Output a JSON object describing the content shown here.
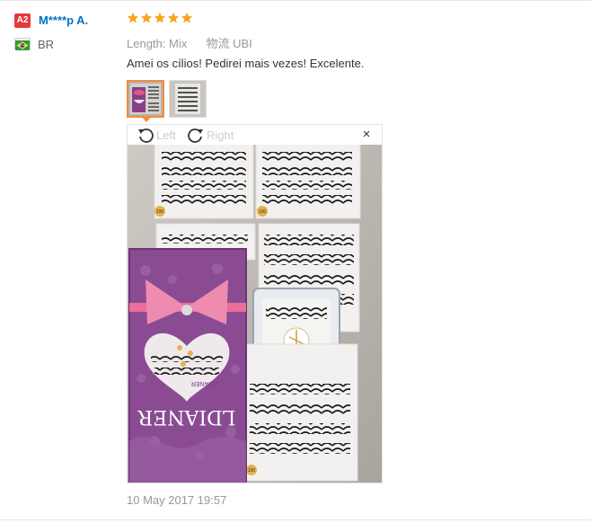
{
  "user": {
    "level_badge": "A2",
    "name": "M****p A.",
    "country_code": "BR"
  },
  "review": {
    "rating": 5,
    "star_color": "#f5a623",
    "properties": [
      {
        "key": "Length:",
        "value": "Mix"
      },
      {
        "key": "物流",
        "value": "UBI"
      }
    ],
    "text": "Amei os cílios! Pedirei mais vezes! Excelente.",
    "timestamp": "10 May 2017 19:57"
  },
  "thumbnails": [
    {
      "selected": true
    },
    {
      "selected": false
    }
  ],
  "viewer": {
    "rotate_left_label": "Left",
    "rotate_right_label": "Right",
    "close_label": "×"
  },
  "photo": {
    "box_brand": "LDIANER",
    "box_brand_inner": "LDIANER",
    "tray_numbers": [
      "100",
      "100",
      "100"
    ]
  },
  "colors": {
    "link_blue": "#0073c6",
    "badge_red": "#e4393c",
    "selected_orange": "#f58a3c"
  }
}
